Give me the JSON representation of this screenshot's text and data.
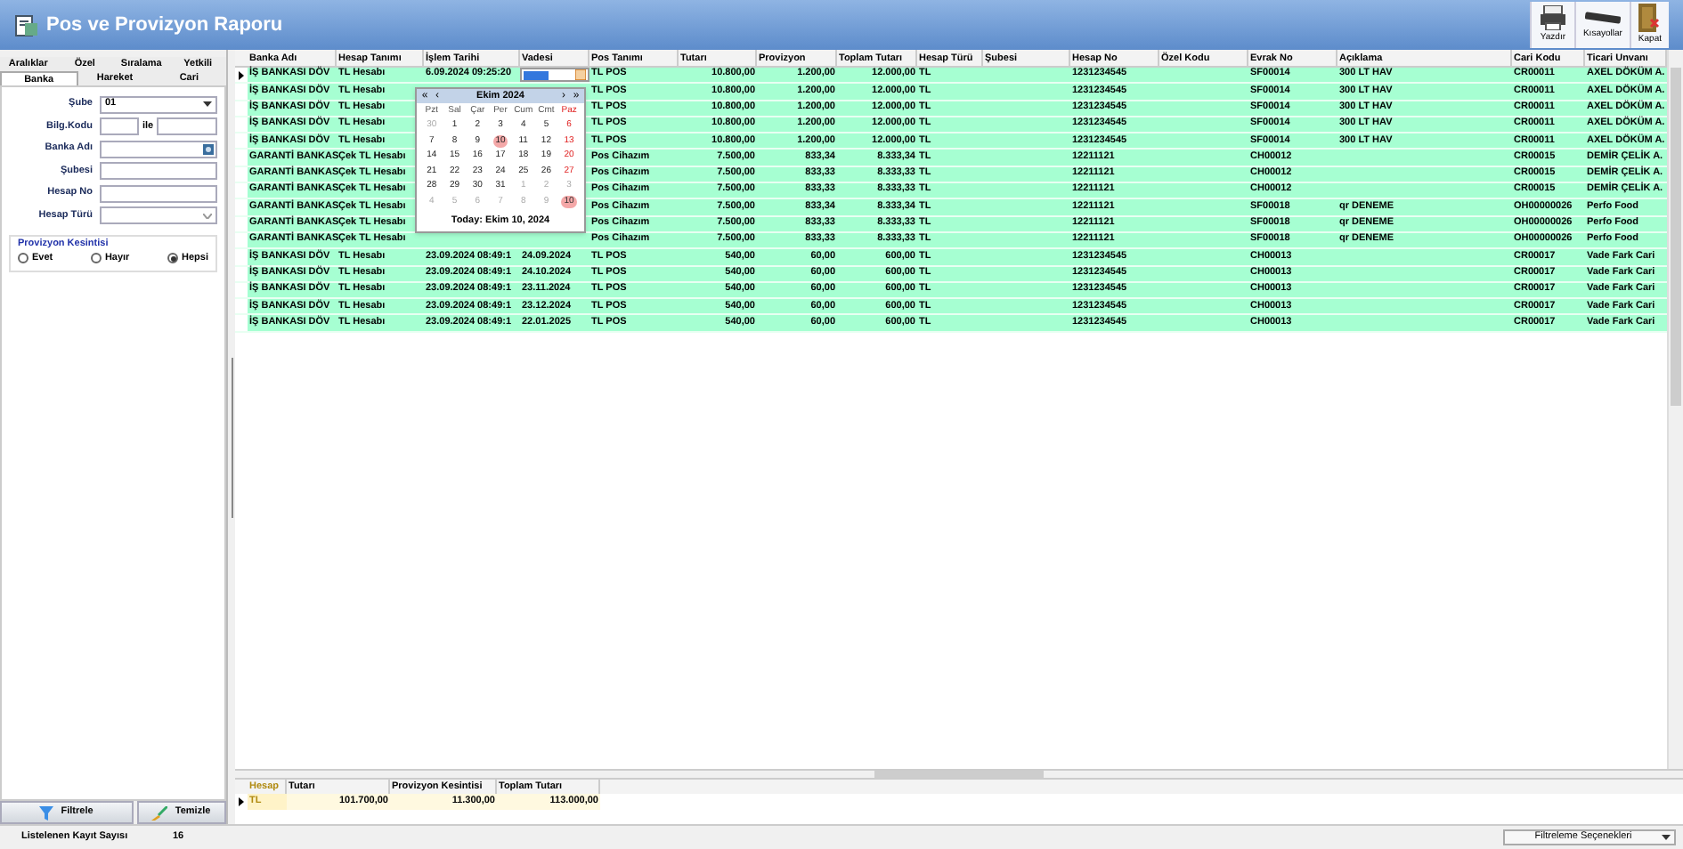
{
  "window": {
    "title": "Pos ve Provizyon Raporu"
  },
  "toolbar": [
    {
      "label": "Yazdır",
      "kind": "printer"
    },
    {
      "label": "Kısayollar",
      "kind": "keyboard"
    },
    {
      "label": "Kapat",
      "kind": "door"
    }
  ],
  "filter_tabs": [
    [
      {
        "label": "Aralıklar",
        "selected": false
      },
      {
        "label": "Özel",
        "selected": false
      },
      {
        "label": "Sıralama",
        "selected": false
      },
      {
        "label": "Yetkili",
        "selected": false
      }
    ],
    [
      {
        "label": "Banka",
        "selected": true
      },
      {
        "label": "Hareket",
        "selected": false
      },
      {
        "label": "Cari",
        "selected": false
      }
    ]
  ],
  "filters": {
    "sube": {
      "label": "Şube",
      "value": "01"
    },
    "bilg_kodu": {
      "label": "Bilg.Kodu",
      "between": "ile"
    },
    "banka_adi": {
      "label": "Banka Adı"
    },
    "subesi": {
      "label": "Şubesi"
    },
    "hesap_no": {
      "label": "Hesap No"
    },
    "hesap_turu": {
      "label": "Hesap Türü"
    }
  },
  "provizyon": {
    "title": "Provizyon Kesintisi",
    "options": [
      {
        "label": "Evet",
        "selected": false
      },
      {
        "label": "Hayır",
        "selected": false
      },
      {
        "label": "Hepsi",
        "selected": true
      }
    ]
  },
  "buttons": [
    {
      "label": "Filtrele",
      "kind": "filter"
    },
    {
      "label": "Temizle",
      "kind": "clear"
    }
  ],
  "status": {
    "label": "Listelenen Kayıt Sayısı",
    "count": "16",
    "options": "Filtreleme Seçenekleri"
  },
  "table": {
    "columns": [
      "Banka Adı",
      "Hesap Tanımı",
      "İşlem Tarihi",
      "Vadesi",
      "Pos Tanımı",
      "Tutarı",
      "Provizyon",
      "Toplam Tutarı",
      "Hesap Türü",
      "Şubesi",
      "Hesap No",
      "Özel Kodu",
      "Evrak No",
      "Açıklama",
      "Cari Kodu",
      "Ticari Unvanı"
    ],
    "rows": [
      {
        "current": true,
        "editing": true,
        "cells": [
          "İŞ BANKASI DÖV",
          "TL Hesabı",
          "6.09.2024 09:25:20",
          null,
          "TL POS",
          "10.800,00",
          "1.200,00",
          "12.000,00",
          "TL",
          null,
          "1231234545",
          null,
          "SF00014",
          "300 LT HAV",
          "CR00011",
          "AXEL DÖKÜM A."
        ]
      },
      {
        "current": false,
        "editing": false,
        "cells": [
          "İŞ BANKASI DÖV",
          "TL Hesabı",
          null,
          null,
          "TL POS",
          "10.800,00",
          "1.200,00",
          "12.000,00",
          "TL",
          null,
          "1231234545",
          null,
          "SF00014",
          "300 LT HAV",
          "CR00011",
          "AXEL DÖKÜM A."
        ]
      },
      {
        "current": false,
        "editing": false,
        "cells": [
          "İŞ BANKASI DÖV",
          "TL Hesabı",
          null,
          null,
          "TL POS",
          "10.800,00",
          "1.200,00",
          "12.000,00",
          "TL",
          null,
          "1231234545",
          null,
          "SF00014",
          "300 LT HAV",
          "CR00011",
          "AXEL DÖKÜM A."
        ]
      },
      {
        "current": false,
        "editing": false,
        "cells": [
          "İŞ BANKASI DÖV",
          "TL Hesabı",
          null,
          null,
          "TL POS",
          "10.800,00",
          "1.200,00",
          "12.000,00",
          "TL",
          null,
          "1231234545",
          null,
          "SF00014",
          "300 LT HAV",
          "CR00011",
          "AXEL DÖKÜM A."
        ]
      },
      {
        "current": false,
        "editing": false,
        "cells": [
          "İŞ BANKASI DÖV",
          "TL Hesabı",
          null,
          null,
          "TL POS",
          "10.800,00",
          "1.200,00",
          "12.000,00",
          "TL",
          null,
          "1231234545",
          null,
          "SF00014",
          "300 LT HAV",
          "CR00011",
          "AXEL DÖKÜM A."
        ]
      },
      {
        "current": false,
        "editing": false,
        "cells": [
          "GARANTİ BANKAS",
          "Çek TL Hesabı",
          null,
          null,
          "Pos Cihazım",
          "7.500,00",
          "833,34",
          "8.333,34",
          "TL",
          null,
          "12211121",
          null,
          "CH00012",
          null,
          "CR00015",
          "DEMİR ÇELİK A."
        ]
      },
      {
        "current": false,
        "editing": false,
        "cells": [
          "GARANTİ BANKAS",
          "Çek TL Hesabı",
          null,
          null,
          "Pos Cihazım",
          "7.500,00",
          "833,33",
          "8.333,33",
          "TL",
          null,
          "12211121",
          null,
          "CH00012",
          null,
          "CR00015",
          "DEMİR ÇELİK A."
        ]
      },
      {
        "current": false,
        "editing": false,
        "cells": [
          "GARANTİ BANKAS",
          "Çek TL Hesabı",
          null,
          null,
          "Pos Cihazım",
          "7.500,00",
          "833,33",
          "8.333,33",
          "TL",
          null,
          "12211121",
          null,
          "CH00012",
          null,
          "CR00015",
          "DEMİR ÇELİK A."
        ]
      },
      {
        "current": false,
        "editing": false,
        "cells": [
          "GARANTİ BANKAS",
          "Çek TL Hesabı",
          null,
          null,
          "Pos Cihazım",
          "7.500,00",
          "833,34",
          "8.333,34",
          "TL",
          null,
          "12211121",
          null,
          "SF00018",
          "qr DENEME",
          "OH00000026",
          "Perfo Food"
        ]
      },
      {
        "current": false,
        "editing": false,
        "cells": [
          "GARANTİ BANKAS",
          "Çek TL Hesabı",
          null,
          null,
          "Pos Cihazım",
          "7.500,00",
          "833,33",
          "8.333,33",
          "TL",
          null,
          "12211121",
          null,
          "SF00018",
          "qr DENEME",
          "OH00000026",
          "Perfo Food"
        ]
      },
      {
        "current": false,
        "editing": false,
        "cells": [
          "GARANTİ BANKAS",
          "Çek TL Hesabı",
          null,
          null,
          "Pos Cihazım",
          "7.500,00",
          "833,33",
          "8.333,33",
          "TL",
          null,
          "12211121",
          null,
          "SF00018",
          "qr DENEME",
          "OH00000026",
          "Perfo Food"
        ]
      },
      {
        "current": false,
        "editing": false,
        "cells": [
          "İŞ BANKASI DÖV",
          "TL Hesabı",
          "23.09.2024 08:49:1",
          "24.09.2024",
          "TL POS",
          "540,00",
          "60,00",
          "600,00",
          "TL",
          null,
          "1231234545",
          null,
          "CH00013",
          null,
          "CR00017",
          "Vade Fark Cari"
        ]
      },
      {
        "current": false,
        "editing": false,
        "cells": [
          "İŞ BANKASI DÖV",
          "TL Hesabı",
          "23.09.2024 08:49:1",
          "24.10.2024",
          "TL POS",
          "540,00",
          "60,00",
          "600,00",
          "TL",
          null,
          "1231234545",
          null,
          "CH00013",
          null,
          "CR00017",
          "Vade Fark Cari"
        ]
      },
      {
        "current": false,
        "editing": false,
        "cells": [
          "İŞ BANKASI DÖV",
          "TL Hesabı",
          "23.09.2024 08:49:1",
          "23.11.2024",
          "TL POS",
          "540,00",
          "60,00",
          "600,00",
          "TL",
          null,
          "1231234545",
          null,
          "CH00013",
          null,
          "CR00017",
          "Vade Fark Cari"
        ]
      },
      {
        "current": false,
        "editing": false,
        "cells": [
          "İŞ BANKASI DÖV",
          "TL Hesabı",
          "23.09.2024 08:49:1",
          "23.12.2024",
          "TL POS",
          "540,00",
          "60,00",
          "600,00",
          "TL",
          null,
          "1231234545",
          null,
          "CH00013",
          null,
          "CR00017",
          "Vade Fark Cari"
        ]
      },
      {
        "current": false,
        "editing": false,
        "cells": [
          "İŞ BANKASI DÖV",
          "TL Hesabı",
          "23.09.2024 08:49:1",
          "22.01.2025",
          "TL POS",
          "540,00",
          "60,00",
          "600,00",
          "TL",
          null,
          "1231234545",
          null,
          "CH00013",
          null,
          "CR00017",
          "Vade Fark Cari"
        ]
      }
    ]
  },
  "calendar": {
    "month": "Ekim 2024",
    "nav": [
      "«",
      "‹",
      "›",
      "»"
    ],
    "weekdays": [
      "Pzt",
      "Sal",
      "Çar",
      "Per",
      "Cum",
      "Cmt",
      "Paz"
    ],
    "weeks": [
      [
        {
          "day": "30",
          "other_month": true,
          "selected": false
        },
        {
          "day": "1",
          "other_month": false,
          "selected": false
        },
        {
          "day": "2",
          "other_month": false,
          "selected": false
        },
        {
          "day": "3",
          "other_month": false,
          "selected": false
        },
        {
          "day": "4",
          "other_month": false,
          "selected": false
        },
        {
          "day": "5",
          "other_month": false,
          "selected": false
        },
        {
          "day": "6",
          "other_month": false,
          "selected": false
        }
      ],
      [
        {
          "day": "7",
          "other_month": false,
          "selected": false
        },
        {
          "day": "8",
          "other_month": false,
          "selected": false
        },
        {
          "day": "9",
          "other_month": false,
          "selected": false
        },
        {
          "day": "10",
          "other_month": false,
          "selected": true
        },
        {
          "day": "11",
          "other_month": false,
          "selected": false
        },
        {
          "day": "12",
          "other_month": false,
          "selected": false
        },
        {
          "day": "13",
          "other_month": false,
          "selected": false
        }
      ],
      [
        {
          "day": "14",
          "other_month": false,
          "selected": false
        },
        {
          "day": "15",
          "other_month": false,
          "selected": false
        },
        {
          "day": "16",
          "other_month": false,
          "selected": false
        },
        {
          "day": "17",
          "other_month": false,
          "selected": false
        },
        {
          "day": "18",
          "other_month": false,
          "selected": false
        },
        {
          "day": "19",
          "other_month": false,
          "selected": false
        },
        {
          "day": "20",
          "other_month": false,
          "selected": false
        }
      ],
      [
        {
          "day": "21",
          "other_month": false,
          "selected": false
        },
        {
          "day": "22",
          "other_month": false,
          "selected": false
        },
        {
          "day": "23",
          "other_month": false,
          "selected": false
        },
        {
          "day": "24",
          "other_month": false,
          "selected": false
        },
        {
          "day": "25",
          "other_month": false,
          "selected": false
        },
        {
          "day": "26",
          "other_month": false,
          "selected": false
        },
        {
          "day": "27",
          "other_month": false,
          "selected": false
        }
      ],
      [
        {
          "day": "28",
          "other_month": false,
          "selected": false
        },
        {
          "day": "29",
          "other_month": false,
          "selected": false
        },
        {
          "day": "30",
          "other_month": false,
          "selected": false
        },
        {
          "day": "31",
          "other_month": false,
          "selected": false
        },
        {
          "day": "1",
          "other_month": true,
          "selected": false
        },
        {
          "day": "2",
          "other_month": true,
          "selected": false
        },
        {
          "day": "3",
          "other_month": true,
          "selected": false
        }
      ],
      [
        {
          "day": "4",
          "other_month": true,
          "selected": false
        },
        {
          "day": "5",
          "other_month": true,
          "selected": false
        },
        {
          "day": "6",
          "other_month": true,
          "selected": false
        },
        {
          "day": "7",
          "other_month": true,
          "selected": false
        },
        {
          "day": "8",
          "other_month": true,
          "selected": false
        },
        {
          "day": "9",
          "other_month": true,
          "selected": false
        },
        {
          "day": "10",
          "other_month": true,
          "selected": true
        }
      ]
    ],
    "today": "Today: Ekim 10, 2024"
  },
  "summary": {
    "columns": [
      "Hesap",
      "Tutarı",
      "Provizyon Kesintisi",
      "Toplam Tutarı"
    ],
    "rows": [
      {
        "current": true,
        "cells": [
          "TL",
          "101.700,00",
          "11.300,00",
          "113.000,00"
        ]
      }
    ]
  }
}
